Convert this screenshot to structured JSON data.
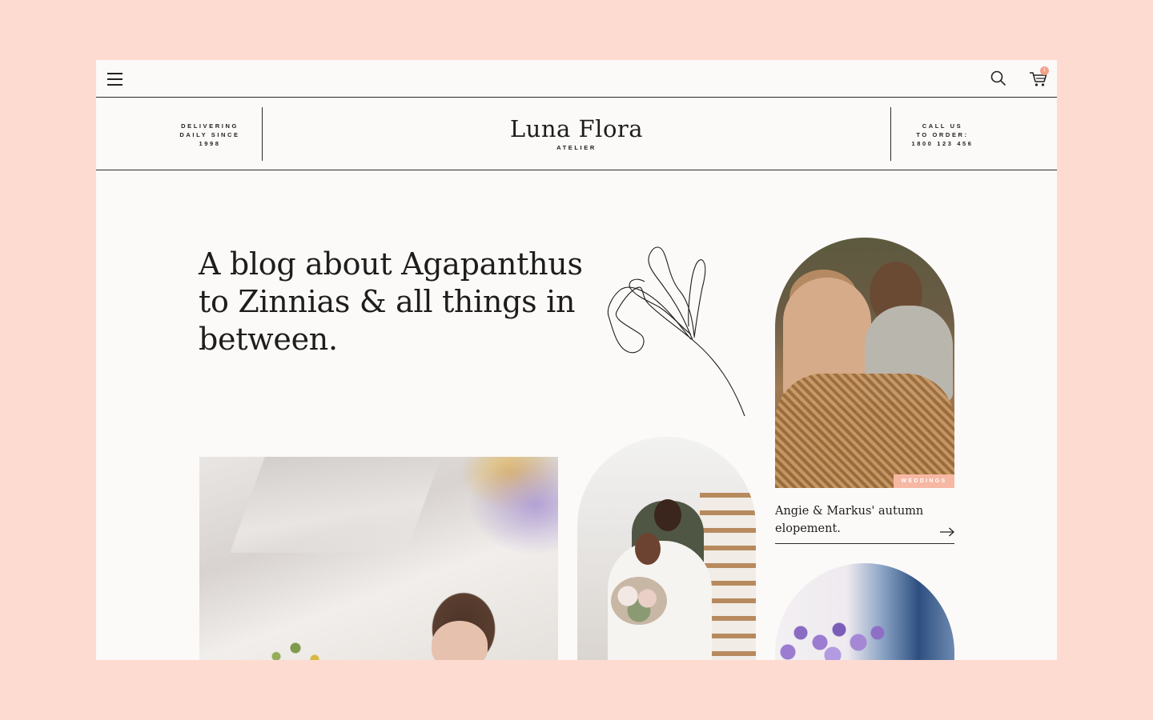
{
  "header": {
    "left_tagline": [
      "DELIVERING",
      "DAILY SINCE",
      "1998"
    ],
    "right_tagline": [
      "CALL US",
      "TO ORDER:",
      "1800 123 456"
    ],
    "logo": "Luna Flora",
    "logo_sub": "ATELIER",
    "cart_count": "1"
  },
  "hero": {
    "title": "A blog about Agapanthus to Zinnias & all things in between."
  },
  "posts": [
    {
      "tag": "WEDDINGS",
      "title": "Angie & Markus' autumn elopement."
    }
  ],
  "colors": {
    "background": "#fddbd0",
    "page": "#fcfaf8",
    "accent": "#f6b7a3",
    "text": "#1d1d1d"
  },
  "icons": [
    "menu-icon",
    "search-icon",
    "cart-icon",
    "arrow-right-icon"
  ]
}
